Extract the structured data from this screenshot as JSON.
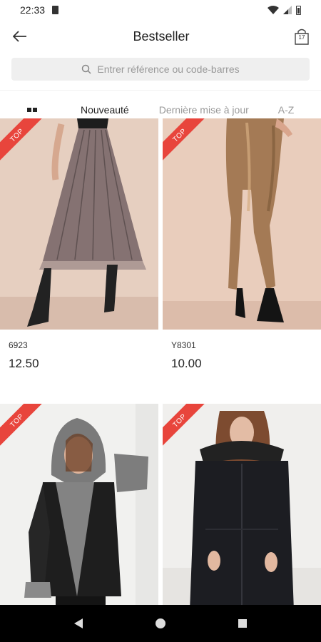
{
  "status_bar": {
    "time": "22:33"
  },
  "header": {
    "title": "Bestseller",
    "cart_count": "17"
  },
  "search": {
    "placeholder": "Entrer référence ou code-barres"
  },
  "sort_tabs": [
    {
      "label": "Nouveauté",
      "active": true
    },
    {
      "label": "Dernière mise à jour",
      "active": false
    },
    {
      "label": "A-Z",
      "active": false
    }
  ],
  "products": [
    {
      "badge": "TOP",
      "ref": "6923",
      "price": "12.50",
      "image": "pleated-skirt-photo"
    },
    {
      "badge": "TOP",
      "ref": "Y8301",
      "price": "10.00",
      "image": "metallic-leggings-photo"
    },
    {
      "badge": "TOP",
      "ref": "",
      "price": "",
      "image": "fur-hood-leather-jacket-photo"
    },
    {
      "badge": "TOP",
      "ref": "",
      "price": "",
      "image": "black-parka-photo"
    }
  ],
  "colors": {
    "badge": "#e8453c",
    "search_bg": "#efefef",
    "nav_bar": "#000000"
  }
}
